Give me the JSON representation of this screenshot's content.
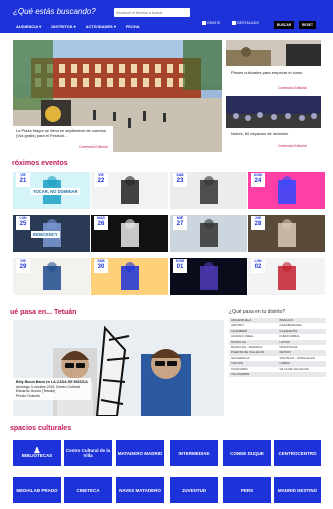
{
  "header": {
    "question": "¿Qué estás buscando?",
    "search_placeholder": "Introduce el término a buscar",
    "nav": [
      "AUDIENCIA ▾",
      "DISTRITOS ▾",
      "ACTIVIDADES ▾",
      "FECHA"
    ],
    "filter_free": "GRATIS",
    "filter_featured": "DESTACADO",
    "search_button": "BUSCAR",
    "reset_button": "RESET"
  },
  "hero": {
    "main_caption": "La Plaza Mayor se llena en septiembre de cuentos (Vía gratis) para el Festival...",
    "main_tag": "Contenido Editorial",
    "side1_caption": "Planes culturales para empezar el curso",
    "side1_tag": "Contenido Editorial",
    "side2_caption": "Nubes, 60 espacios de inclusión",
    "side2_tag": "Contenido Editorial"
  },
  "events_title": "róximos eventos",
  "events": [
    {
      "day": "VIE",
      "num": "21",
      "art": "TOCAR, NO DOMINAR"
    },
    {
      "day": "VIE",
      "num": "22",
      "art": ""
    },
    {
      "day": "SÁB",
      "num": "23",
      "art": ""
    },
    {
      "day": "DOM",
      "num": "24",
      "art": ""
    },
    {
      "day": "LUN",
      "num": "25",
      "art": "INDECENCY"
    },
    {
      "day": "MAR",
      "num": "26",
      "art": ""
    },
    {
      "day": "MIÉ",
      "num": "27",
      "art": ""
    },
    {
      "day": "JUE",
      "num": "28",
      "art": ""
    },
    {
      "day": "VIE",
      "num": "29",
      "art": ""
    },
    {
      "day": "SÁB",
      "num": "30",
      "art": ""
    },
    {
      "day": "DOM",
      "num": "01",
      "art": ""
    },
    {
      "day": "LUN",
      "num": "02",
      "art": ""
    }
  ],
  "tetuan": {
    "title": "ué pasa en... Tetuán",
    "caption_title": "Billy Boom Band en LA CASA DE MÚSICA",
    "caption_body": "domingo 3 octubre 2021 Centro Cultural Eduardo Úrculo (Tetuán)",
    "caption_price": "Precio Gratuito"
  },
  "districts": {
    "title": "¿Qué pasa en tu distrito?",
    "items": [
      "ARGANZUELA",
      "BARAJAS",
      "CENTRO",
      "CARABANCHEL",
      "CHAMBERÍ",
      "CHAMARTÍN",
      "CIUDAD LINEAL",
      "FUENCARRAL",
      "MONCLOA",
      "LATINA",
      "MONCLOA - ARAVACA",
      "MORATALAZ",
      "PUENTE DE VALLECAS",
      "RETIRO",
      "SALAMANCA",
      "SAN BLAS - CANILLEJAS",
      "TETUÁN",
      "USERA",
      "VICÁLVARO",
      "VILLA DE VALLECAS",
      "VILLAVERDE",
      ""
    ]
  },
  "spaces": {
    "title": "spacios culturales",
    "row1": [
      "BIBLIOTECAS",
      "Centro Cultural de la Villa",
      "MATADERO MADRID",
      "INTERMEDIAE",
      "CONDE DUQUE",
      "CENTROCENTRO"
    ],
    "row2": [
      "MEDIALAB PRADO",
      "CINETECA",
      "NAVES MATADERO",
      "JUVENTUD",
      "PERS",
      "MADRID DESTINO"
    ]
  },
  "colors": {
    "brand_blue": "#1d33d9",
    "accent_pink": "#c2185b"
  }
}
